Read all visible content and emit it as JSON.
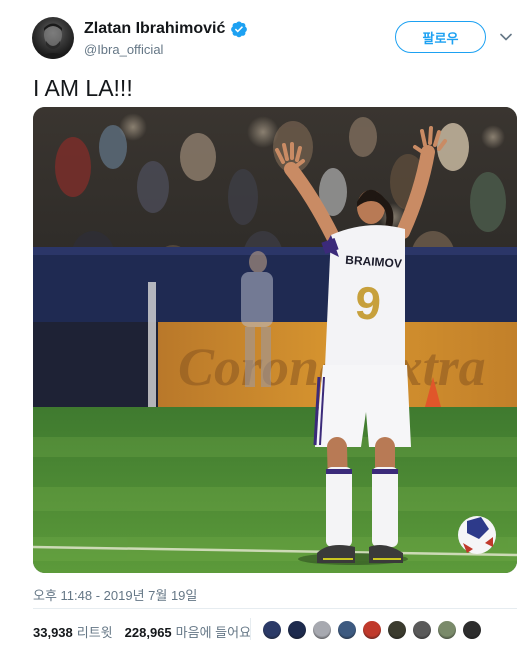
{
  "header": {
    "display_name": "Zlatan Ibrahimović",
    "handle": "@Ibra_official",
    "follow_label": "팔로우"
  },
  "tweet": {
    "text": "I AM LA!!!",
    "timestamp": "오후 11:48 - 2019년 7월 19일"
  },
  "photo": {
    "jersey_name": "BRAIMOV",
    "jersey_number": "9",
    "board_text": "Corona Extra"
  },
  "stats": {
    "retweets_count": "33,938",
    "retweets_label": "리트윗",
    "likes_count": "228,965",
    "likes_label": "마음에 들어요"
  },
  "likers": [
    {
      "color": "#2b3a67"
    },
    {
      "color": "#1d2a4d"
    },
    {
      "color": "#a7a9b0"
    },
    {
      "color": "#3d5a80"
    },
    {
      "color": "#c0392b"
    },
    {
      "color": "#3b3b2e"
    },
    {
      "color": "#5a5a5a"
    },
    {
      "color": "#7a8a6a"
    },
    {
      "color": "#2e2e2e"
    }
  ],
  "colors": {
    "accent": "#1da1f2",
    "secondary_text": "#657786"
  },
  "icons": {
    "verified": "verified-badge-icon",
    "caret": "chevron-down-icon"
  }
}
